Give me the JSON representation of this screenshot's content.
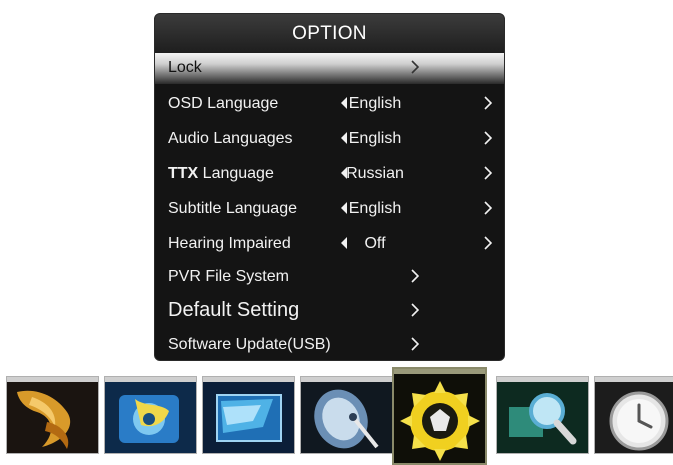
{
  "menu": {
    "title": "OPTION",
    "items": [
      {
        "label": "Lock",
        "value": "",
        "has_left": false
      },
      {
        "label": "OSD Language",
        "value": "English",
        "has_left": true
      },
      {
        "label": "Audio Languages",
        "value": "English",
        "has_left": true
      },
      {
        "label_bold": "TTX",
        "label": " Language",
        "value": "Russian",
        "has_left": true
      },
      {
        "label": "Subtitle Language",
        "value": "English",
        "has_left": true
      },
      {
        "label": "Hearing Impaired",
        "value": "Off",
        "has_left": true
      },
      {
        "label": "PVR File System",
        "value": "",
        "has_left": false
      },
      {
        "label": "Default Setting",
        "value": "",
        "has_left": false
      },
      {
        "label": "Software Update(USB)",
        "value": "",
        "has_left": false
      }
    ]
  },
  "colors": {
    "menu_background": "#141414",
    "selected_highlight": "#cfcfcf",
    "text": "#f2f2f2"
  },
  "bottom_bar": {
    "thumbnails": [
      {
        "name": "picture-menu-icon"
      },
      {
        "name": "sound-menu-icon"
      },
      {
        "name": "screen-menu-icon"
      },
      {
        "name": "channel-menu-icon"
      },
      {
        "name": "option-menu-icon"
      },
      {
        "name": "search-menu-icon"
      },
      {
        "name": "time-menu-icon"
      }
    ],
    "active_index": 4
  }
}
